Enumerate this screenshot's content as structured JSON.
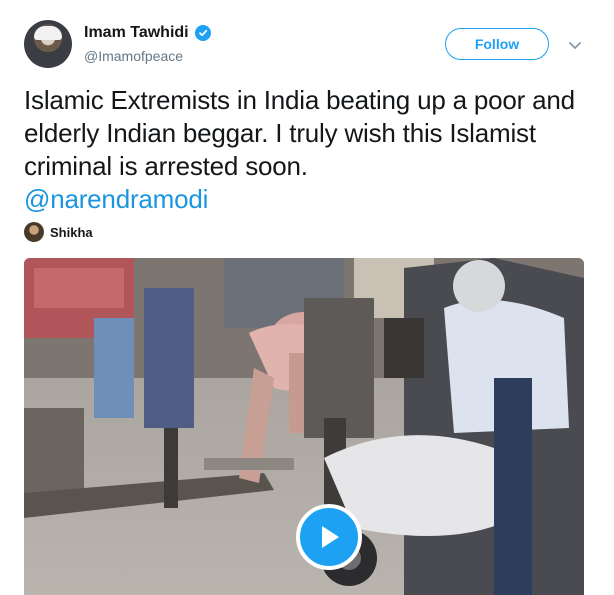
{
  "author": {
    "display_name": "Imam Tawhidi",
    "handle": "@Imamofpeace",
    "verified": true
  },
  "follow_button": {
    "label": "Follow"
  },
  "tweet": {
    "text": "Islamic Extremists in India beating up a poor and elderly Indian beggar. I truly wish this Islamist criminal is arrested soon.",
    "mention": "@narendramodi"
  },
  "tagged_user": {
    "name": "Shikha"
  },
  "media": {
    "type": "video",
    "icon": "play-icon"
  },
  "colors": {
    "accent": "#1da1f2",
    "mention": "#1b95e0",
    "secondary_text": "#657786"
  }
}
